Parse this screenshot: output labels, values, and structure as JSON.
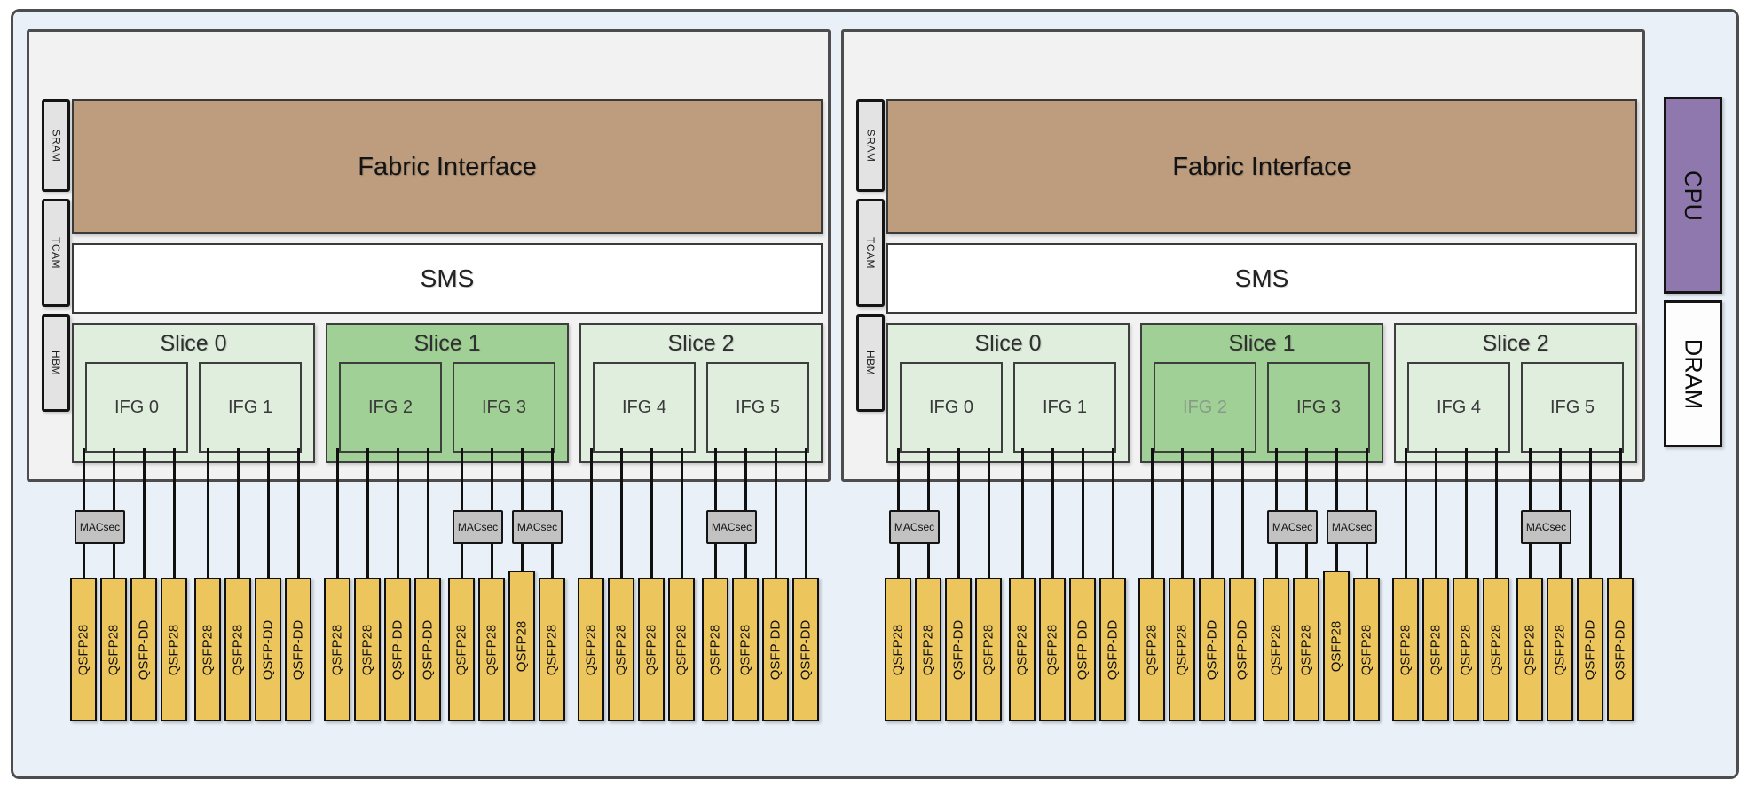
{
  "labels": {
    "macsec": "MACsec"
  },
  "side_blocks": [
    {
      "label": "CPU"
    },
    {
      "label": "DRAM"
    }
  ],
  "colors": {
    "background": "#e9f0f8",
    "chip_fill": "#f2f2f2",
    "memory_fill": "#e3e3e3",
    "fabric_fill": "#bd9d7e",
    "slice_light": "#dfeedd",
    "slice_dark": "#a0d096",
    "macsec_fill": "#c2c2c2",
    "port_fill": "#ecc55c",
    "cpu_fill": "#8f78ad",
    "dram_fill": "#fdfdfd"
  },
  "chips": [
    {
      "memory_blocks": [
        "SRAM",
        "TCAM",
        "HBM"
      ],
      "fabric_label": "Fabric Interface",
      "sms_label": "SMS",
      "slices": [
        {
          "label": "Slice 0",
          "variant": "light",
          "ifgs": [
            {
              "label": "IFG 0"
            },
            {
              "label": "IFG 1"
            }
          ]
        },
        {
          "label": "Slice 1",
          "variant": "dark",
          "ifgs": [
            {
              "label": "IFG 2"
            },
            {
              "label": "IFG 3"
            }
          ]
        },
        {
          "label": "Slice 2",
          "variant": "light",
          "ifgs": [
            {
              "label": "IFG 4"
            },
            {
              "label": "IFG 5"
            }
          ]
        }
      ],
      "port_groups": [
        {
          "ifg": "IFG 0",
          "macsec_on_lines": [
            [
              1,
              2
            ]
          ],
          "ports": [
            "QSFP28",
            "QSFP28",
            "QSFP-DD",
            "QSFP28"
          ]
        },
        {
          "ifg": "IFG 1",
          "macsec_on_lines": [],
          "ports": [
            "QSFP28",
            "QSFP28",
            "QSFP-DD",
            "QSFP-DD"
          ]
        },
        {
          "ifg": "IFG 2",
          "macsec_on_lines": [],
          "ports": [
            "QSFP28",
            "QSFP28",
            "QSFP-DD",
            "QSFP-DD"
          ]
        },
        {
          "ifg": "IFG 3",
          "macsec_on_lines": [
            [
              1,
              2
            ],
            [
              3,
              4
            ]
          ],
          "tall_port_index": 2,
          "ports": [
            "QSFP28",
            "QSFP28",
            "QSFP28",
            "QSFP28"
          ]
        },
        {
          "ifg": "IFG 4",
          "macsec_on_lines": [],
          "ports": [
            "QSFP28",
            "QSFP28",
            "QSFP28",
            "QSFP28"
          ]
        },
        {
          "ifg": "IFG 5",
          "macsec_on_lines": [
            [
              1,
              2
            ]
          ],
          "ports": [
            "QSFP28",
            "QSFP28",
            "QSFP-DD",
            "QSFP-DD"
          ]
        }
      ]
    },
    {
      "memory_blocks": [
        "SRAM",
        "TCAM",
        "HBM"
      ],
      "fabric_label": "Fabric Interface",
      "sms_label": "SMS",
      "slices": [
        {
          "label": "Slice 0",
          "variant": "light",
          "ifgs": [
            {
              "label": "IFG 0"
            },
            {
              "label": "IFG 1"
            }
          ]
        },
        {
          "label": "Slice 1",
          "variant": "dark",
          "ifgs": [
            {
              "label": "IFG 2",
              "muted": true
            },
            {
              "label": "IFG 3"
            }
          ]
        },
        {
          "label": "Slice 2",
          "variant": "light",
          "ifgs": [
            {
              "label": "IFG 4"
            },
            {
              "label": "IFG 5"
            }
          ]
        }
      ],
      "port_groups": [
        {
          "ifg": "IFG 0",
          "macsec_on_lines": [
            [
              1,
              2
            ]
          ],
          "ports": [
            "QSFP28",
            "QSFP28",
            "QSFP-DD",
            "QSFP28"
          ]
        },
        {
          "ifg": "IFG 1",
          "macsec_on_lines": [],
          "ports": [
            "QSFP28",
            "QSFP28",
            "QSFP-DD",
            "QSFP-DD"
          ]
        },
        {
          "ifg": "IFG 2",
          "macsec_on_lines": [],
          "ports": [
            "QSFP28",
            "QSFP28",
            "QSFP-DD",
            "QSFP-DD"
          ]
        },
        {
          "ifg": "IFG 3",
          "macsec_on_lines": [
            [
              1,
              2
            ],
            [
              3,
              4
            ]
          ],
          "tall_port_index": 2,
          "ports": [
            "QSFP28",
            "QSFP28",
            "QSFP28",
            "QSFP28"
          ]
        },
        {
          "ifg": "IFG 4",
          "macsec_on_lines": [],
          "ports": [
            "QSFP28",
            "QSFP28",
            "QSFP28",
            "QSFP28"
          ]
        },
        {
          "ifg": "IFG 5",
          "macsec_on_lines": [
            [
              1,
              2
            ]
          ],
          "ports": [
            "QSFP28",
            "QSFP28",
            "QSFP-DD",
            "QSFP-DD"
          ]
        }
      ]
    }
  ]
}
